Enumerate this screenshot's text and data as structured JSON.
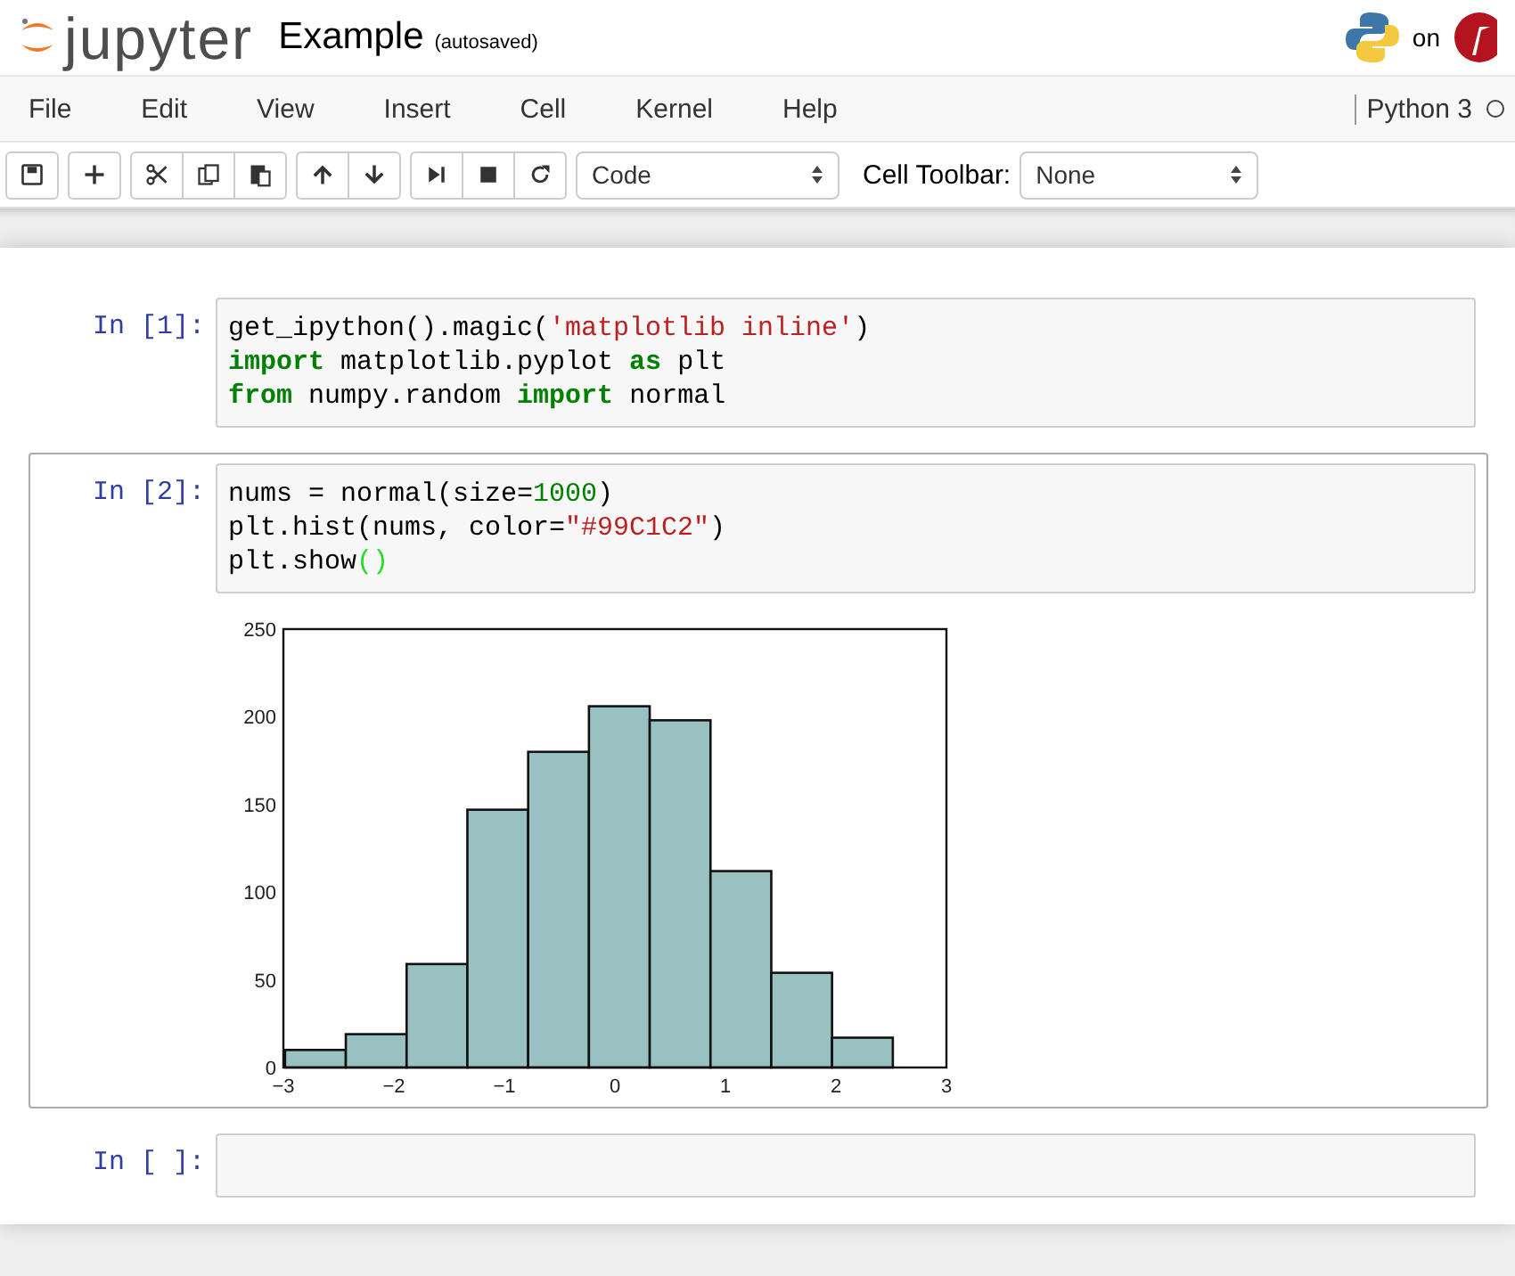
{
  "header": {
    "logo_text": "jupyter",
    "notebook_name": "Example",
    "save_status": "(autosaved)",
    "host_label": "on"
  },
  "menu": [
    "File",
    "Edit",
    "View",
    "Insert",
    "Cell",
    "Kernel",
    "Help"
  ],
  "kernel": {
    "name": "Python 3",
    "busy": false
  },
  "toolbar": {
    "cell_type": "Code",
    "cell_toolbar_label": "Cell Toolbar:",
    "cell_toolbar_value": "None"
  },
  "cells": [
    {
      "prompt": "In [1]:",
      "selected": false,
      "lines": [
        [
          {
            "text": "get_ipython().magic(",
            "kind": "plain"
          },
          {
            "text": "'matplotlib inline'",
            "kind": "string"
          },
          {
            "text": ")",
            "kind": "plain"
          }
        ],
        [
          {
            "text": "import",
            "kind": "keyword"
          },
          {
            "text": " matplotlib.pyplot ",
            "kind": "plain"
          },
          {
            "text": "as",
            "kind": "keyword"
          },
          {
            "text": " plt",
            "kind": "plain"
          }
        ],
        [
          {
            "text": "from",
            "kind": "keyword"
          },
          {
            "text": " numpy.random ",
            "kind": "plain"
          },
          {
            "text": "import",
            "kind": "keyword"
          },
          {
            "text": " normal",
            "kind": "plain"
          }
        ]
      ]
    },
    {
      "prompt": "In [2]:",
      "selected": true,
      "lines": [
        [
          {
            "text": "nums = normal(size=",
            "kind": "plain"
          },
          {
            "text": "1000",
            "kind": "number"
          },
          {
            "text": ")",
            "kind": "plain"
          }
        ],
        [
          {
            "text": "plt.hist(nums, color=",
            "kind": "plain"
          },
          {
            "text": "\"#99C1C2\"",
            "kind": "string"
          },
          {
            "text": ")",
            "kind": "plain"
          }
        ],
        [
          {
            "text": "plt.show",
            "kind": "plain"
          },
          {
            "text": "()",
            "kind": "bracket"
          }
        ]
      ],
      "output": {
        "chart_data": {
          "type": "bar",
          "x": [
            -2.71,
            -2.16,
            -1.61,
            -1.06,
            -0.51,
            0.04,
            0.59,
            1.14,
            1.69,
            2.24
          ],
          "series": [
            {
              "color": "#99c1c2",
              "values": [
                10,
                19,
                59,
                147,
                180,
                206,
                198,
                112,
                54,
                17
              ]
            }
          ],
          "xlim": [
            -3,
            3
          ],
          "ylim": [
            0,
            250
          ],
          "xticks": [
            {
              "value": -3,
              "label": "−3"
            },
            {
              "value": -2,
              "label": "−2"
            },
            {
              "value": -1,
              "label": "−1"
            },
            0,
            1,
            2,
            3
          ],
          "yticks": [
            0,
            50,
            100,
            150,
            200,
            250
          ]
        }
      }
    },
    {
      "prompt": "In [ ]:",
      "selected": false
    }
  ]
}
